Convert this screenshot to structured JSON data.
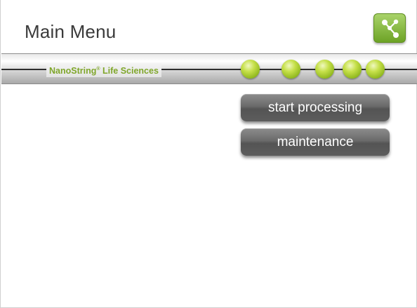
{
  "header": {
    "title": "Main Menu",
    "app_icon": "network-nodes-icon"
  },
  "banner": {
    "brand_name": "NanoString",
    "brand_mark": "®",
    "brand_suffix": "Life Sciences",
    "indicator_count": 5,
    "indicator_color": "#a8cc2c"
  },
  "menu": {
    "start_processing_label": "start processing",
    "maintenance_label": "maintenance"
  },
  "colors": {
    "accent_green": "#7fa62a",
    "button_gray": "#5d5d5d",
    "title_text": "#3a3a3a"
  }
}
